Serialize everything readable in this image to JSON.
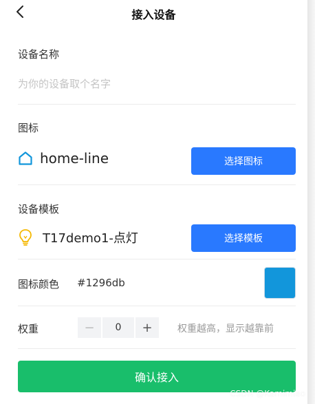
{
  "header": {
    "title": "接入设备",
    "back_icon": "chevron-left-icon"
  },
  "device_name": {
    "label": "设备名称",
    "placeholder": "为你的设备取个名字"
  },
  "icon_section": {
    "label": "图标",
    "selected_icon": "home-line",
    "icon_glyph": "home-icon",
    "button_label": "选择图标"
  },
  "template_section": {
    "label": "设备模板",
    "selected_template": "T17demo1-点灯",
    "icon_glyph": "lightbulb-icon",
    "button_label": "选择模板"
  },
  "color_section": {
    "label": "图标颜色",
    "value": "#1296db"
  },
  "weight_section": {
    "label": "权重",
    "minus": "−",
    "value": "0",
    "plus": "+",
    "hint": "权重越高，显示越靠前"
  },
  "submit": {
    "label": "确认接入"
  },
  "watermark": "CSDN @Kamimiao",
  "colors": {
    "accent_blue": "#2979ff",
    "confirm_green": "#19be6b",
    "icon_color": "#1296db",
    "bulb_yellow": "#f5b800"
  }
}
